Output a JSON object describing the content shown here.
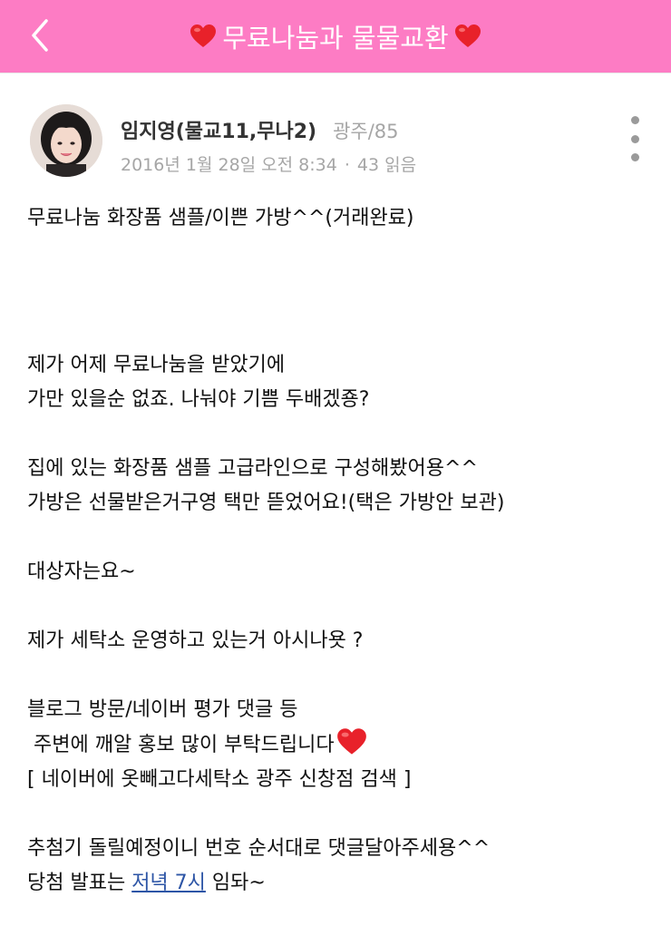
{
  "header": {
    "title": "무료나눔과 물물교환",
    "background": "#fd7cc4"
  },
  "author": {
    "name": "임지영(물교11,무나2)",
    "region": "광주/85",
    "date": "2016년 1월 28일 오전 8:34",
    "separator": "·",
    "views": "43 읽음"
  },
  "post": {
    "title": "무료나눔 화장품 샘플/이쁜 가방^^(거래완료)",
    "lines": [
      "제가 어제 무료나눔을 받았기에",
      "가만 있을순 없죠. 나눠야 기쁨 두배겠죵?",
      "집에 있는 화장품 샘플 고급라인으로 구성해봤어용^^",
      "가방은 선물받은거구영 택만 뜯었어요!(택은 가방안 보관)",
      "대상자는요~",
      "제가 세탁소 운영하고 있는거 아시나욧 ?",
      "블로그 방문/네이버 평가 댓글 등",
      " 주변에 깨알 홍보 많이 부탁드립니다",
      "[ 네이버에 옷빼고다세탁소 광주 신창점 검색 ]",
      "추첨기 돌릴예정이니 번호 순서대로 댓글달아주세용^^",
      "당첨 발표는 ",
      "저녁 7시",
      " 임돠~"
    ],
    "link_color": "#2d55a6"
  },
  "icons": {
    "back": "chevron-left-icon",
    "heart": "heart-icon",
    "more": "more-vertical-icon"
  }
}
